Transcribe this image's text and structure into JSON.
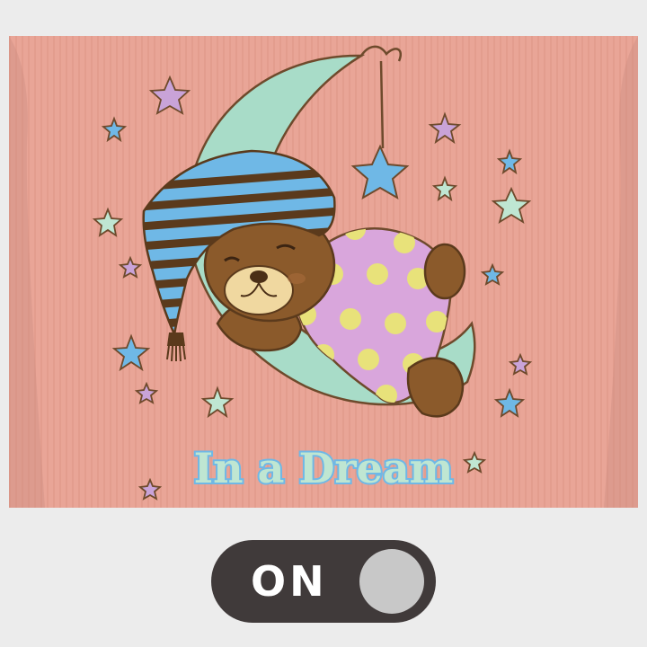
{
  "image": {
    "alt": "Pink ribbed shirt with a teddy bear in a striped nightcap sleeping on a crescent moon under a polka-dot blanket, surrounded by stars",
    "print_text": "In a Dream",
    "colors": {
      "fabric": "#e9a597",
      "moon": "#a8dcc8",
      "blanket": "#d9a6dc",
      "dots": "#e8e27a",
      "bear": "#8b5a2b",
      "hat_blue": "#6fb8e6",
      "star_blue": "#6fb8e6",
      "star_purple": "#c9a3d8",
      "star_mint": "#bfe6d2"
    }
  },
  "toggle": {
    "label": "ON",
    "state": "on",
    "track_color": "#403a3a",
    "knob_color": "#c8c8c8"
  }
}
